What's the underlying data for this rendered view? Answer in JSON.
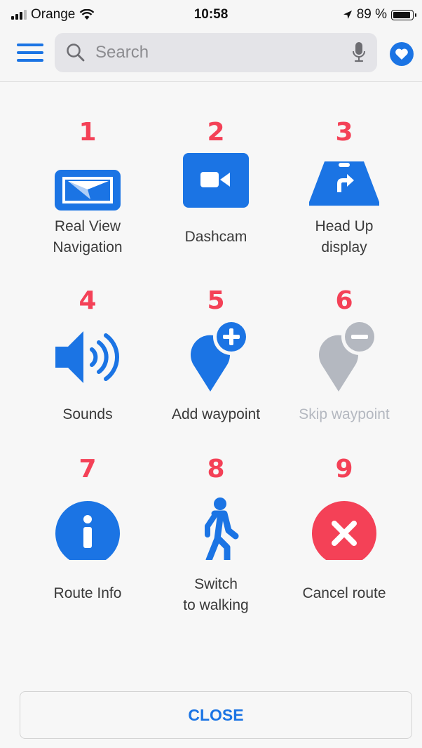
{
  "status_bar": {
    "carrier": "Orange",
    "time": "10:58",
    "battery": "89 %"
  },
  "search": {
    "placeholder": "Search"
  },
  "colors": {
    "accent": "#1b74e4",
    "number": "#f44157",
    "danger": "#f44157",
    "disabled": "#b4b8c0"
  },
  "tiles": [
    {
      "number": "1",
      "label": "Real View\nNavigation",
      "icon": "real-view-navigation-icon"
    },
    {
      "number": "2",
      "label": "Dashcam",
      "icon": "dashcam-icon"
    },
    {
      "number": "3",
      "label": "Head Up\ndisplay",
      "icon": "head-up-display-icon"
    },
    {
      "number": "4",
      "label": "Sounds",
      "icon": "sound-icon"
    },
    {
      "number": "5",
      "label": "Add waypoint",
      "icon": "add-waypoint-icon"
    },
    {
      "number": "6",
      "label": "Skip waypoint",
      "icon": "skip-waypoint-icon",
      "disabled": true
    },
    {
      "number": "7",
      "label": "Route Info",
      "icon": "info-icon"
    },
    {
      "number": "8",
      "label": "Switch\nto walking",
      "icon": "walking-icon"
    },
    {
      "number": "9",
      "label": "Cancel route",
      "icon": "cancel-icon"
    }
  ],
  "close_label": "CLOSE"
}
